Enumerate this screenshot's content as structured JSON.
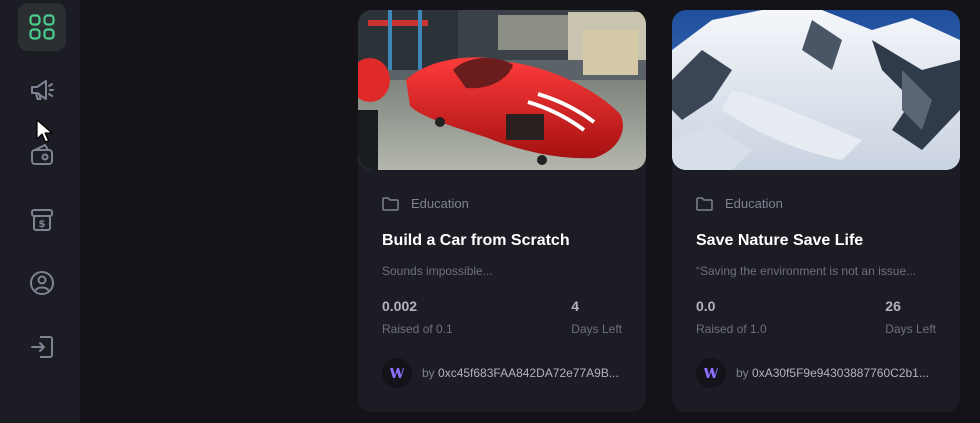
{
  "sidebar": {
    "items": [
      {
        "icon": "dashboard-icon",
        "active": true
      },
      {
        "icon": "megaphone-icon",
        "active": false
      },
      {
        "icon": "wallet-icon",
        "active": false
      },
      {
        "icon": "payment-icon",
        "active": false
      },
      {
        "icon": "profile-icon",
        "active": false
      },
      {
        "icon": "logout-icon",
        "active": false
      }
    ],
    "accent": "#4acd8d"
  },
  "campaigns": [
    {
      "image": "red-car-in-workshop",
      "category": "Education",
      "title": "Build a Car from Scratch",
      "description": "Sounds impossible...",
      "raised": "0.002",
      "raised_label": "Raised of 0.1",
      "days": "4",
      "days_label": "Days Left",
      "by": "by",
      "owner": "0xc45f683FAA842DA72e77A9B..."
    },
    {
      "image": "snowy-mountains",
      "category": "Education",
      "title": "Save Nature Save Life",
      "description": "“Saving the environment is not an issue...",
      "raised": "0.0",
      "raised_label": "Raised of 1.0",
      "days": "26",
      "days_label": "Days Left",
      "by": "by",
      "owner": "0xA30f5F9e94303887760C2b1..."
    }
  ],
  "colors": {
    "background": "#131318",
    "sidebar": "#1c1c24",
    "card": "#1c1c24",
    "owner_logo": "#8c6dfd"
  }
}
